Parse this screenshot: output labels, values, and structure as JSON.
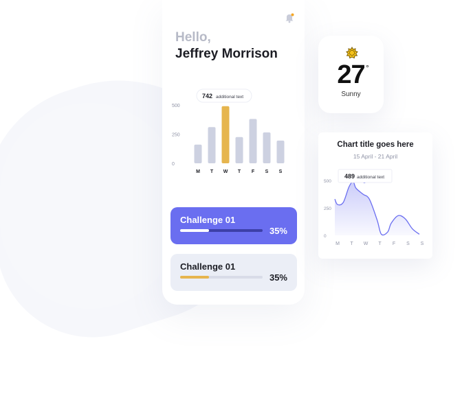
{
  "greeting": "Hello,",
  "user_name": "Jeffrey Morrison",
  "icons": {
    "notification": "bell-icon",
    "weather": "sun-icon"
  },
  "colors": {
    "accent": "#6a6ef0",
    "highlight": "#e6b54e",
    "bar": "#cdd1e1",
    "notification_dot": "#f5a623"
  },
  "bar_chart": {
    "chart_data": {
      "type": "bar",
      "categories": [
        "M",
        "T",
        "W",
        "T",
        "F",
        "S",
        "S"
      ],
      "values": [
        160,
        310,
        490,
        225,
        380,
        265,
        195
      ],
      "highlight_index": 2,
      "ylim": [
        0,
        500
      ],
      "yticks": [
        "500",
        "250",
        "0"
      ],
      "tooltip": {
        "value": "742",
        "text": "additional text"
      }
    }
  },
  "challenges": [
    {
      "title": "Challenge 01",
      "percent_label": "35%",
      "progress": 0.35,
      "style": "active"
    },
    {
      "title": "Challenge 01",
      "percent_label": "35%",
      "progress": 0.35,
      "style": "inactive"
    }
  ],
  "weather": {
    "temperature": "27",
    "degree_symbol": "°",
    "condition": "Sunny"
  },
  "area_chart": {
    "title": "Chart title goes here",
    "subtitle": "15 April - 21 April",
    "chart_data": {
      "type": "area",
      "categories": [
        "M",
        "T",
        "W",
        "T",
        "F",
        "S",
        "S"
      ],
      "x": [
        0,
        0.2,
        0.6,
        1,
        1.3,
        1.5,
        2,
        2.45,
        3,
        3.3,
        3.75,
        4,
        4.5,
        5,
        5.5,
        6
      ],
      "y": [
        330,
        280,
        300,
        440,
        489,
        430,
        375,
        330,
        140,
        10,
        30,
        110,
        180,
        150,
        60,
        10
      ],
      "ylim": [
        0,
        500
      ],
      "yticks": [
        "500",
        "250",
        "0"
      ],
      "tooltip": {
        "value": "489",
        "text": "additional text",
        "x": 2
      }
    }
  }
}
